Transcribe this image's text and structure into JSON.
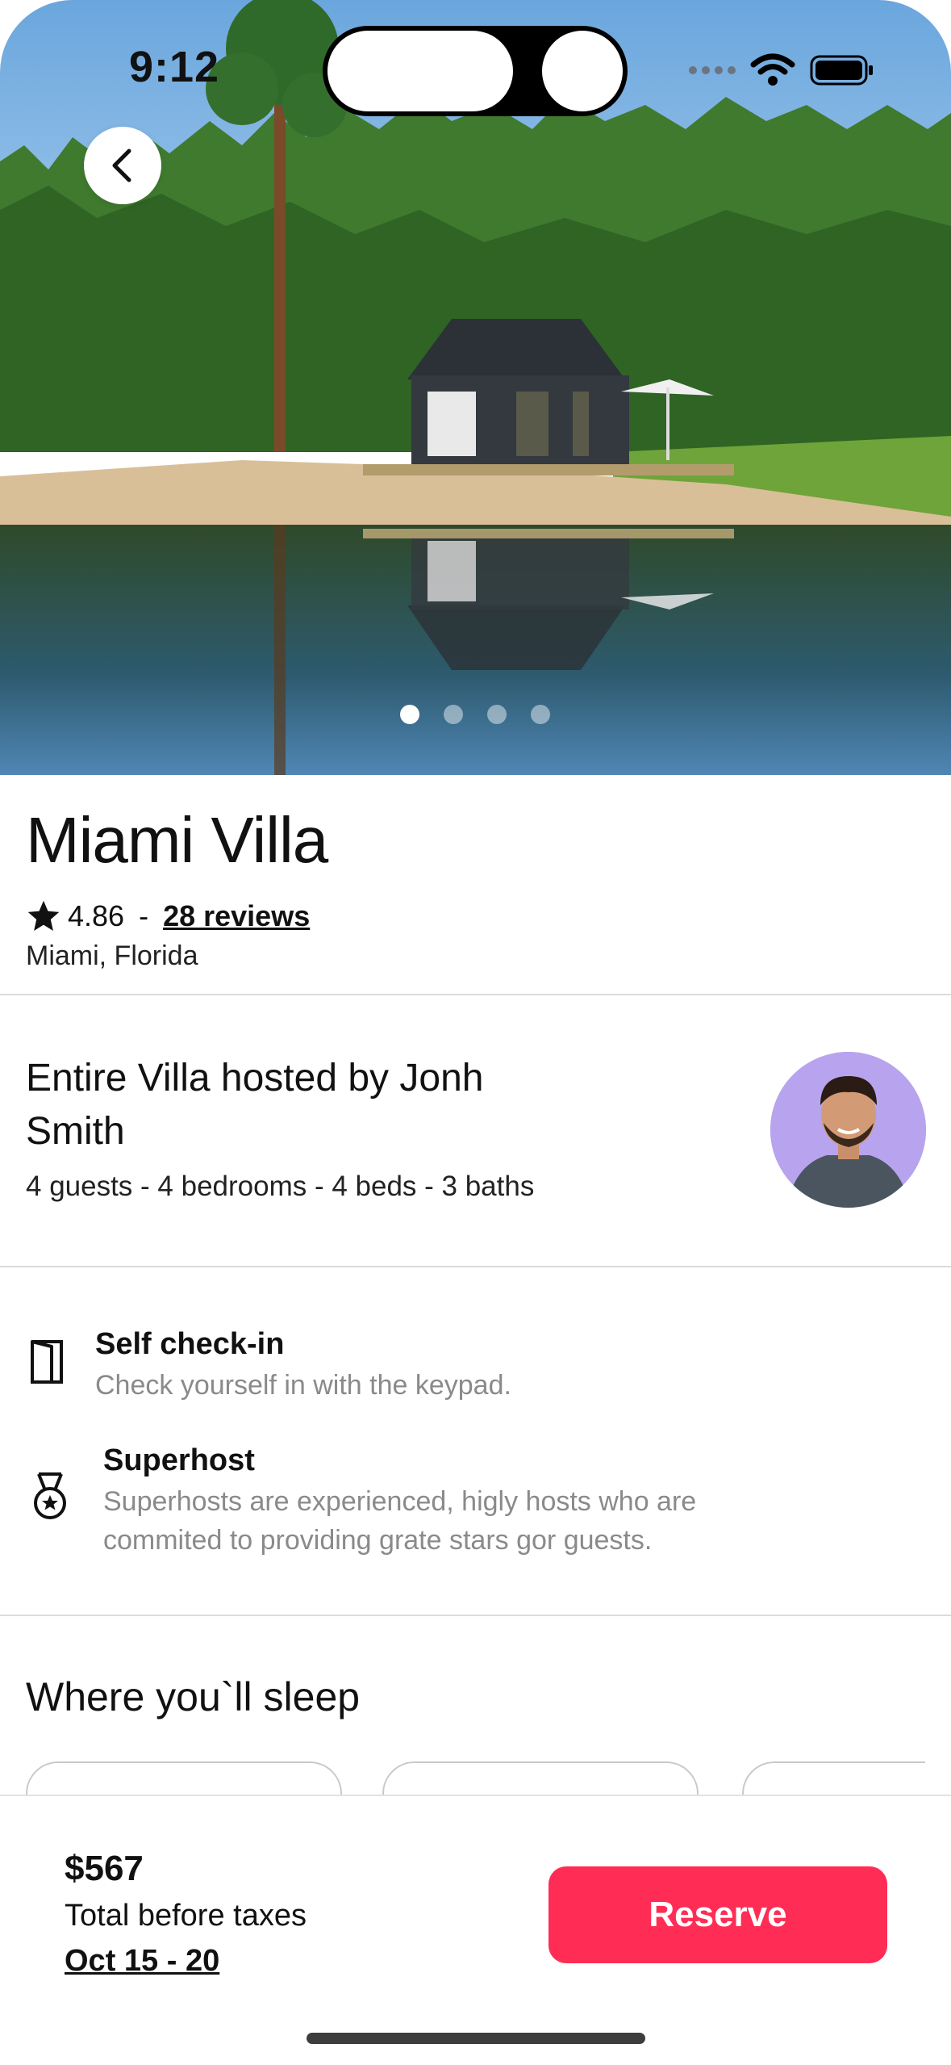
{
  "status_bar": {
    "time": "9:12"
  },
  "listing": {
    "title": "Miami Villa",
    "rating": "4.86",
    "separator": "-",
    "reviews_link": "28 reviews",
    "location": "Miami, Florida"
  },
  "gallery": {
    "image_count": 4,
    "active_index": 0
  },
  "host": {
    "title": "Entire Villa hosted by Jonh Smith",
    "details": "4 guests - 4 bedrooms - 4 beds - 3 baths"
  },
  "features": [
    {
      "icon": "door-icon",
      "title": "Self check-in",
      "description": "Check yourself in with the keypad."
    },
    {
      "icon": "medal-icon",
      "title": "Superhost",
      "description": "Superhosts are experienced, higly hosts who are commited to providing grate stars gor guests."
    }
  ],
  "sleep": {
    "title": "Where you`ll sleep"
  },
  "booking": {
    "price": "$567",
    "price_note": "Total before taxes",
    "dates": "Oct 15 - 20",
    "reserve_label": "Reserve"
  },
  "colors": {
    "accent": "#ff2d55",
    "avatar_bg": "#b7a3ee"
  }
}
